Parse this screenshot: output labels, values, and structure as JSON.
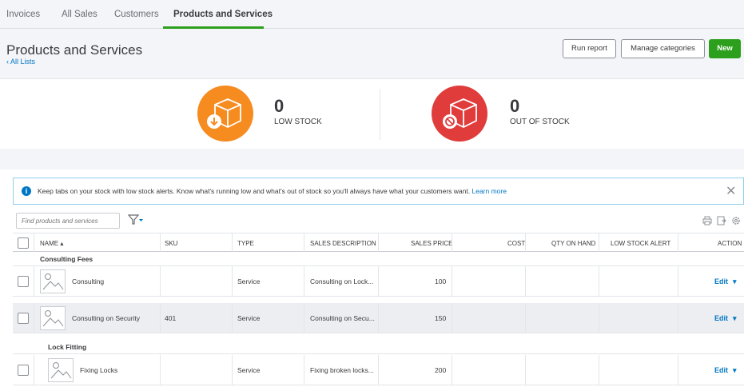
{
  "tabs": [
    {
      "label": "Invoices"
    },
    {
      "label": "All Sales"
    },
    {
      "label": "Customers"
    },
    {
      "label": "Products and Services"
    }
  ],
  "header": {
    "title": "Products and Services",
    "back_link": "All Lists",
    "run_report": "Run report",
    "manage_categories": "Manage categories",
    "new": "New"
  },
  "stock": {
    "low": {
      "count": "0",
      "label": "LOW STOCK",
      "color": "#f68b1f"
    },
    "out": {
      "count": "0",
      "label": "OUT OF STOCK",
      "color": "#e03c3c"
    }
  },
  "alert": {
    "text": "Keep tabs on your stock with low stock alerts. Know what's running low and what's out of stock so you'll always have what your customers want.",
    "link": "Learn more"
  },
  "search": {
    "placeholder": "Find products and services"
  },
  "columns": {
    "name": "NAME ▴",
    "sku": "SKU",
    "type": "TYPE",
    "sales_description": "SALES DESCRIPTION",
    "sales_price": "SALES PRICE",
    "cost": "COST",
    "qty_on_hand": "QTY ON HAND",
    "low_stock_alert": "LOW STOCK ALERT",
    "action": "ACTION"
  },
  "groups": [
    {
      "label": "Consulting Fees"
    },
    {
      "label": "Lock Fitting"
    }
  ],
  "rows": [
    {
      "name": "Consulting",
      "sku": "",
      "type": "Service",
      "description": "Consulting on Lock...",
      "price": "100",
      "action": "Edit"
    },
    {
      "name": "Consulting on Security",
      "sku": "401",
      "type": "Service",
      "description": "Consulting on Secu...",
      "price": "150",
      "action": "Edit"
    },
    {
      "name": "Fixing Locks",
      "sku": "",
      "type": "Service",
      "description": "Fixing broken locks...",
      "price": "200",
      "action": "Edit"
    }
  ],
  "colors": {
    "accent": "#2ca01c",
    "link": "#0077c5"
  }
}
